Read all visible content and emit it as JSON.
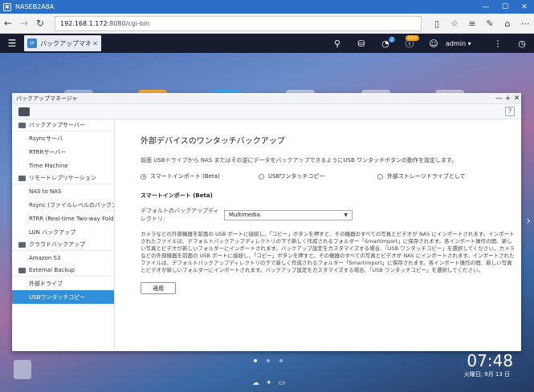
{
  "window_title": "NASEB2A8A",
  "browser": {
    "url_host": "192.168.1.172",
    "url_path": ":8080/cgi-bin"
  },
  "qts": {
    "tab_label": "バックアップマネ...",
    "notif_count": "2",
    "info_badge": "10+",
    "user": "admin"
  },
  "app": {
    "title": "バックアップマネージャ",
    "sidebar": {
      "groups": [
        {
          "label": "バックアップサーバー",
          "items": [
            "Rsyncサーバ",
            "RTRRサーバー",
            "Time Machine"
          ]
        },
        {
          "label": "リモートレプリケーション",
          "items": [
            "NAS to NAS",
            "Rsync (ファイルレベルのバックアップ...",
            "RTRR (Real-time Two-way Folder...",
            "LUN バックアップ"
          ]
        },
        {
          "label": "クラウドバックアップ",
          "items": [
            "Amazon S3"
          ]
        },
        {
          "label": "External Backup",
          "items": [
            "外部ドライブ",
            "USBワンタッチコピー"
          ]
        }
      ]
    },
    "content": {
      "title": "外部デバイスのワンタッチバックアップ",
      "description": "前面 USBドライブから NAS またはその逆にデータをバックアップできるようにUSB ワンタッチボタンの動作を設定します。",
      "radios": [
        {
          "label": "スマートインポート (Beta)",
          "selected": true
        },
        {
          "label": "USBワンタッチコピー",
          "selected": false
        },
        {
          "label": "外部ストレージドライブとして",
          "selected": false
        }
      ],
      "section_title": "スマートインポート (Beta)",
      "default_dir_label": "デフォルトのバックアップディレクトリ:",
      "default_dir_value": "Multimedia",
      "paragraph1": "カメラなどの外部機器を前面の USB ポートに接続し、「コピー」ボタンを押すと、その機器のすべての写真とビデオが NAS にインポートされます。インポートされたファイルは、デフォルトバックアップディレクトリの下で新しく作成されるフォルダー「SmartImport」に保存されます。各インポート操作の間、新しい写真とビデオが新しいフォルダーにインポートされます。バックアップ設定をカスタマイズする場合、「USB ワンタッチコピー」を選択してください。カメラなどの外部機器を前面の USB ポートに接続し、「コピー」ボタンを押すと、その機器のすべての写真とビデオが NAS にインポートされます。インポートされたファイルは、デフォルトバックアップディレクトリの下で新しく作成されるフォルダー「SmartImport」に保存されます。各インポート操作の間、新しい写真とビデオが新しいフォルダーにインポートされます。バックアップ設定をカスタマイズする場合、「USB ワンタッチコピー」を選択してください。",
      "apply_label": "適用"
    }
  },
  "desktop": {
    "time": "07:48",
    "date": "火曜日, 9月 13 日"
  }
}
